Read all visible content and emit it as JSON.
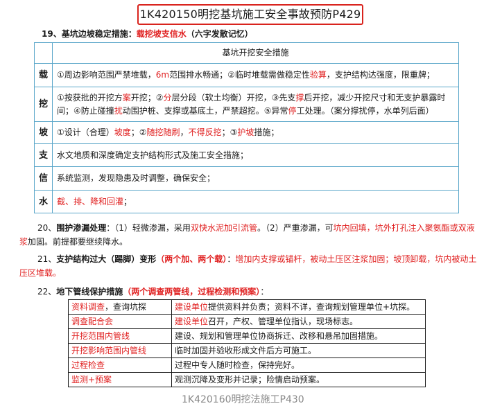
{
  "title": "1K420150明挖基坑施工安全事故预防P429",
  "s19": {
    "label": "19、基坑边坡稳定措施：",
    "keyword": "载挖坡支信水",
    "note": "（六字发散记忆）"
  },
  "table_header": "基坑开挖安全措施",
  "rows": [
    {
      "key": "载",
      "parts": [
        [
          "①周边影响范围严禁堆载，",
          ""
        ],
        [
          "6m",
          "red"
        ],
        [
          "范围排水畅通；②临时堆载需做稳定性",
          ""
        ],
        [
          "验算",
          "red"
        ],
        [
          "，支护结构达强度，限重牌；",
          ""
        ]
      ]
    },
    {
      "key": "挖",
      "parts": [
        [
          "①按获批的开挖方",
          ""
        ],
        [
          "案",
          "red"
        ],
        [
          "开挖；②",
          ""
        ],
        [
          "分",
          "red"
        ],
        [
          "层分段（软土均衡）开挖，③先支",
          ""
        ],
        [
          "撑",
          "red"
        ],
        [
          "后开挖，减少开挖尺寸和无支护暴露时间；④防止碰撞",
          ""
        ],
        [
          "扰",
          "red"
        ],
        [
          "动围护桩、支撑或基底土，严禁超挖。⑤异常",
          ""
        ],
        [
          "停",
          "red"
        ],
        [
          "工处理。（案分撑扰停，水单列后面）",
          ""
        ]
      ]
    },
    {
      "key": "坡",
      "parts": [
        [
          "①设计（合理）",
          ""
        ],
        [
          "坡度",
          "red"
        ],
        [
          "；②",
          ""
        ],
        [
          "随挖随刷",
          "red"
        ],
        [
          "，",
          ""
        ],
        [
          "不得反挖",
          "red"
        ],
        [
          "；③",
          ""
        ],
        [
          "护坡",
          "red"
        ],
        [
          "措施；",
          ""
        ]
      ]
    },
    {
      "key": "支",
      "parts": [
        [
          "水文地质和深度确定支护结构形式及施工安全措施；",
          ""
        ]
      ]
    },
    {
      "key": "信",
      "parts": [
        [
          "系统监测，发现隐患及时调整，确保安全；",
          ""
        ]
      ]
    },
    {
      "key": "水",
      "parts": [
        [
          "截、排、降和回灌",
          "red"
        ],
        [
          "；",
          ""
        ]
      ]
    }
  ],
  "p20": [
    [
      "20、",
      ""
    ],
    [
      "围护渗漏处理",
      "b"
    ],
    [
      "：（1）轻微渗漏，采用",
      ""
    ],
    [
      "双快水泥加引流管",
      "red"
    ],
    [
      "。（2）严重渗漏，可",
      ""
    ],
    [
      "坑内回填，坑外打孔注入聚氨酯或双液浆",
      "red"
    ],
    [
      "加固。前提都要继续降水。",
      ""
    ]
  ],
  "p21": [
    [
      "21、",
      ""
    ],
    [
      "支护结构过大（踢脚）变形",
      "b"
    ],
    [
      "（两个加、两个载）",
      "redb"
    ],
    [
      "：",
      ""
    ],
    [
      "增加内支撑或锚杆，被动土压区注浆加固；坡顶卸载，坑内被动土压区堆载。",
      "red"
    ]
  ],
  "p22": [
    [
      "22、",
      ""
    ],
    [
      "地下管线保护措施",
      "b"
    ],
    [
      "（两个调查两管线，过程检测和预案）",
      "redb"
    ],
    [
      "：",
      ""
    ]
  ],
  "sub_rows": [
    {
      "c1": [
        [
          "资料调查",
          "red"
        ],
        [
          "，查询坑探",
          ""
        ]
      ],
      "c2": [
        [
          "建设单位",
          "red"
        ],
        [
          "提供资料并负责；资料不详，查询规划管理单位+坑探。",
          ""
        ]
      ]
    },
    {
      "c1": [
        [
          "调查配合会",
          "red"
        ]
      ],
      "c2": [
        [
          "建设单位",
          "red"
        ],
        [
          "召开，产权、管理单位指认，现场标志。",
          ""
        ]
      ]
    },
    {
      "c1": [
        [
          "开挖范围内管线",
          "red"
        ]
      ],
      "c2": [
        [
          "建设、规划和管理单位协商拆迁、改移和悬吊加固措施。",
          ""
        ]
      ]
    },
    {
      "c1": [
        [
          "开挖影响范围内管线",
          "red"
        ]
      ],
      "c2": [
        [
          "临时加固并验收形成文件后方可施工。",
          ""
        ]
      ]
    },
    {
      "c1": [
        [
          "过程检查",
          "red"
        ]
      ],
      "c2": [
        [
          "过程中专人随时检查，保持完好。",
          ""
        ]
      ]
    },
    {
      "c1": [
        [
          "监测+预案",
          "red"
        ]
      ],
      "c2": [
        [
          "观测沉降及变形并记录；险情启动预案。",
          ""
        ]
      ]
    }
  ],
  "cutoff_text": "1K420160明挖法施工P430"
}
